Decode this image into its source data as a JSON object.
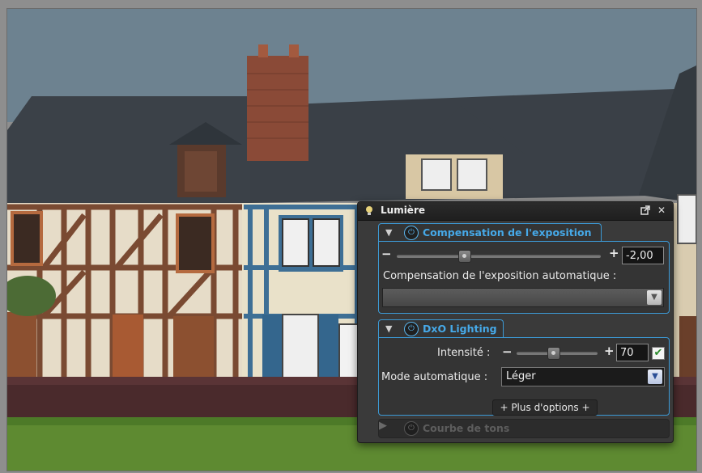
{
  "palette": {
    "title": "Lumière",
    "icons": {
      "panel": "light-bulb-icon",
      "float": "float-palette-icon",
      "close": "close-icon"
    }
  },
  "exposure": {
    "title": "Compensation de l'exposition",
    "minus": "−",
    "plus": "+",
    "value": "-2,00",
    "slider_fraction": 0.33,
    "auto_label": "Compensation de l'exposition automatique :",
    "auto_value": ""
  },
  "lighting": {
    "title": "DxO Lighting",
    "intensity_label": "Intensité :",
    "minus": "−",
    "plus": "+",
    "intensity_value": "70",
    "intensity_fraction": 0.45,
    "checked": true,
    "mode_label": "Mode automatique :",
    "mode_value": "Léger",
    "more_options": "+ Plus d'options +"
  },
  "curves": {
    "title": "Courbe de tons"
  },
  "colors": {
    "accent": "#46a9e8",
    "panel": "#3a3a3a",
    "titlebar": "#1f1f1f"
  }
}
